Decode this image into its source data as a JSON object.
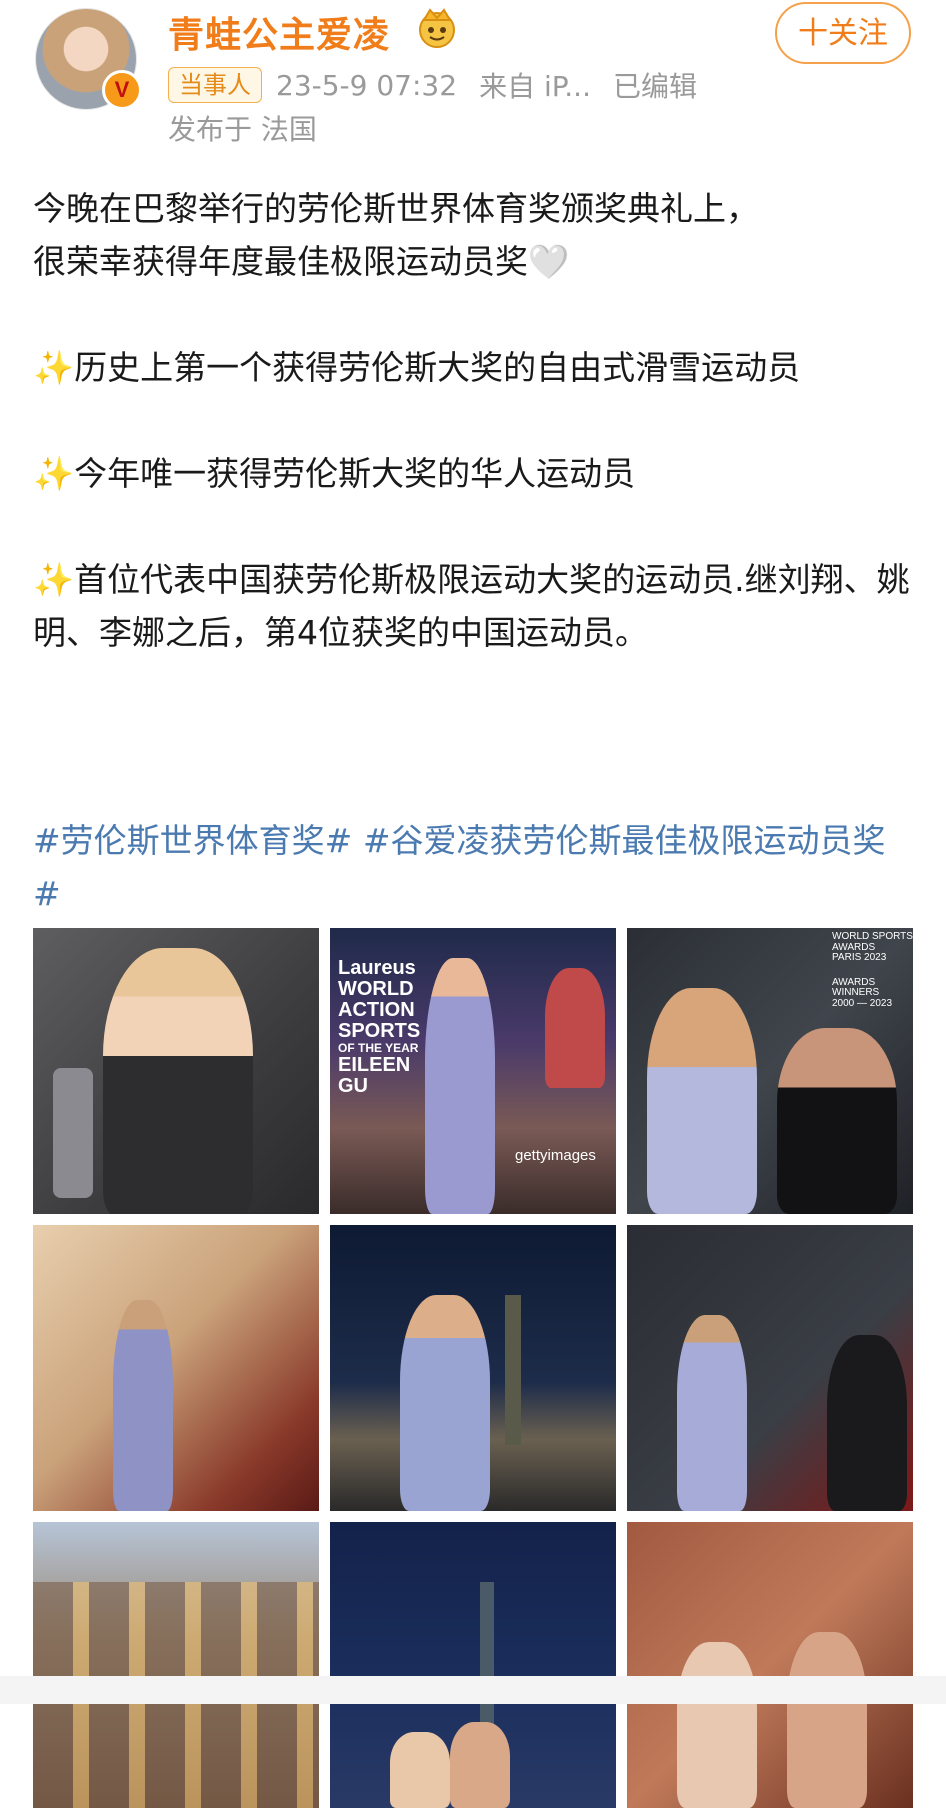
{
  "header": {
    "username": "青蛙公主爱凌",
    "follow_label": "十关注",
    "verified_mark": "V",
    "badge": "当事人",
    "timestamp": "23-5-9 07:32",
    "source": "来自 iP...",
    "edited": "已编辑",
    "location": "发布于 法国"
  },
  "post": {
    "line1": "今晚在巴黎举行的劳伦斯世界体育奖颁奖典礼上，",
    "line2": "很荣幸获得年度最佳极限运动员奖",
    "heart_emoji": "🤍",
    "spark_emoji": "✨",
    "bullet1": "历史上第一个获得劳伦斯大奖的自由式滑雪运动员",
    "bullet2": "今年唯一获得劳伦斯大奖的华人运动员",
    "bullet3": "首位代表中国获劳伦斯极限运动大奖的运动员.继刘翔、姚明、李娜之后，第4位获奖的中国运动员。"
  },
  "hashtags": [
    "#劳伦斯世界体育奖#",
    "#谷爱凌获劳伦斯最佳极限运动员奖#"
  ],
  "photos": {
    "p2_lines": [
      "Laureus",
      "WORLD",
      "ACTION",
      "SPORTS",
      "OF THE YEAR",
      "EILEEN",
      "GU"
    ],
    "p2_watermark": "gettyimages",
    "p3_lines": [
      "WORLD SPORTS",
      "AWARDS",
      "PARIS 2023",
      "AWARDS WINNERS",
      "2000 — 2023"
    ]
  }
}
